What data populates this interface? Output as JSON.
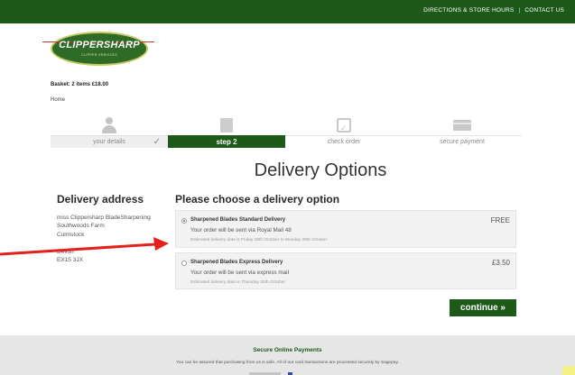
{
  "topbar": {
    "directions": "DIRECTIONS & STORE HOURS",
    "separator": "|",
    "contact": "CONTACT US"
  },
  "logo": {
    "name": "CLIPPERSHARP",
    "tagline": "CLIPPER SERVICES"
  },
  "basket": "Basket: 2 items £18.00",
  "breadcrumb": "Home",
  "steps": [
    {
      "label": "your details",
      "icon": "person-icon",
      "state": "done",
      "check": "✓"
    },
    {
      "label": "step 2",
      "icon": "trolley-icon",
      "state": "active"
    },
    {
      "label": "check order",
      "icon": "bag-check-icon",
      "state": "pending"
    },
    {
      "label": "secure payment",
      "icon": "credit-card-icon",
      "state": "pending"
    }
  ],
  "page_title": "Delivery Options",
  "address": {
    "title": "Delivery address",
    "lines": [
      "miss Clippersharp BladeSharpening",
      "Southwoods Farm",
      "Culmstock",
      "",
      "Devon",
      "EX15 3JX"
    ]
  },
  "options_title": "Please choose a delivery option",
  "options": [
    {
      "name": "Sharpened Blades Standard Delivery",
      "desc": "Your order will be sent via Royal Mail 48",
      "estimate": "Estimated delivery date is Friday 26th October to Monday 29th October",
      "price": "FREE",
      "selected": true
    },
    {
      "name": "Sharpened Blades Express Delivery",
      "desc": "Your order will be sent via express mail",
      "estimate": "Estimated delivery date is Thursday 25th October",
      "price": "£3.50",
      "selected": false
    }
  ],
  "continue_label": "continue »",
  "footer": {
    "title": "Secure Online Payments",
    "text": "You can be assured that purchasing from us is safe. All of our card transactions are processed securely by Sagepay."
  },
  "colors": {
    "brand_green": "#1d5a1a",
    "arrow_red": "#e3231b",
    "option_bg": "#f2f2f2",
    "footer_bg": "#e6e6e6"
  }
}
